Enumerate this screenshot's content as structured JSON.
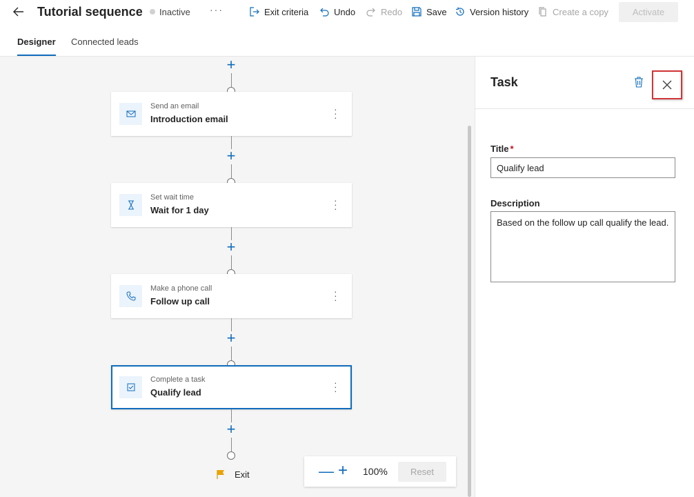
{
  "header": {
    "title": "Tutorial sequence",
    "status": "Inactive",
    "more_label": "···",
    "exit_criteria": "Exit criteria",
    "undo": "Undo",
    "redo": "Redo",
    "save": "Save",
    "version_history": "Version history",
    "create_copy": "Create a copy",
    "activate": "Activate"
  },
  "tabs": [
    {
      "label": "Designer",
      "active": true
    },
    {
      "label": "Connected leads",
      "active": false
    }
  ],
  "steps": [
    {
      "type": "Send an email",
      "name": "Introduction email",
      "icon": "mail-icon"
    },
    {
      "type": "Set wait time",
      "name": "Wait for 1 day",
      "icon": "hourglass-icon"
    },
    {
      "type": "Make a phone call",
      "name": "Follow up call",
      "icon": "phone-icon"
    },
    {
      "type": "Complete a task",
      "name": "Qualify lead",
      "icon": "task-check-icon",
      "selected": true
    }
  ],
  "exit_label": "Exit",
  "zoom": {
    "level": "100%",
    "reset": "Reset"
  },
  "panel": {
    "title": "Task",
    "title_label": "Title",
    "required_mark": "*",
    "title_value": "Qualify lead",
    "description_label": "Description",
    "description_value": "Based on the follow up call qualify the lead."
  },
  "colors": {
    "accent": "#0f6cbd",
    "highlight_border": "#d13438",
    "canvas": "#f5f5f5"
  }
}
